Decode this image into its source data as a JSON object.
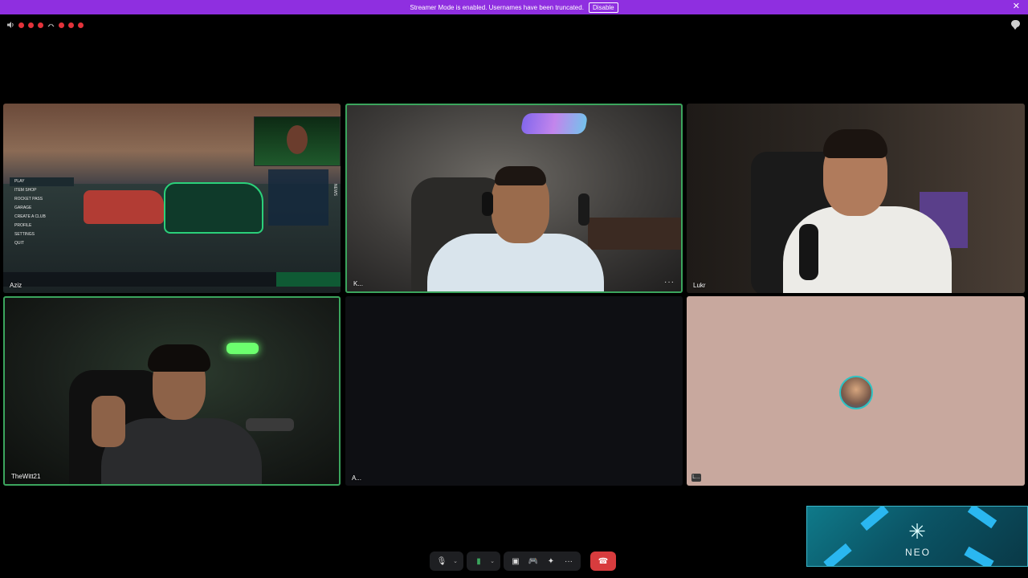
{
  "banner": {
    "message": "Streamer Mode is enabled. Usernames have been truncated.",
    "disable_label": "Disable",
    "close_glyph": "✕",
    "color": "#8f2fe0"
  },
  "top_bar": {
    "speaker_icon": "speaker-icon",
    "chat_icon": "chat-bubble-icon"
  },
  "tiles": [
    {
      "name": "Aziz",
      "speaking": false,
      "game_menu": [
        "PLAY",
        "ITEM SHOP",
        "ROCKET PASS",
        "GARAGE",
        "CREATE A CLUB",
        "PROFILE",
        "SETTINGS",
        "QUIT"
      ],
      "news_label": "NEWS"
    },
    {
      "name": "K...",
      "speaking": true
    },
    {
      "name": "Lukr",
      "speaking": false
    },
    {
      "name": "TheWitt21",
      "speaking": true
    },
    {
      "name": "A...",
      "speaking": false
    },
    {
      "name": "L...",
      "speaking": false
    }
  ],
  "more_options_glyph": "···",
  "toolbar": {
    "mic_glyph": "🎙",
    "camera_glyph": "▮",
    "share_glyph": "▣",
    "activity_glyph": "🎮",
    "soundboard_glyph": "✦",
    "more_glyph": "···",
    "hangup_glyph": "☎",
    "chevron": "⌄"
  },
  "overlay": {
    "brand": "NEO"
  },
  "colors": {
    "speaking_border": "#3ba55d",
    "hangup": "#d83c3e"
  }
}
